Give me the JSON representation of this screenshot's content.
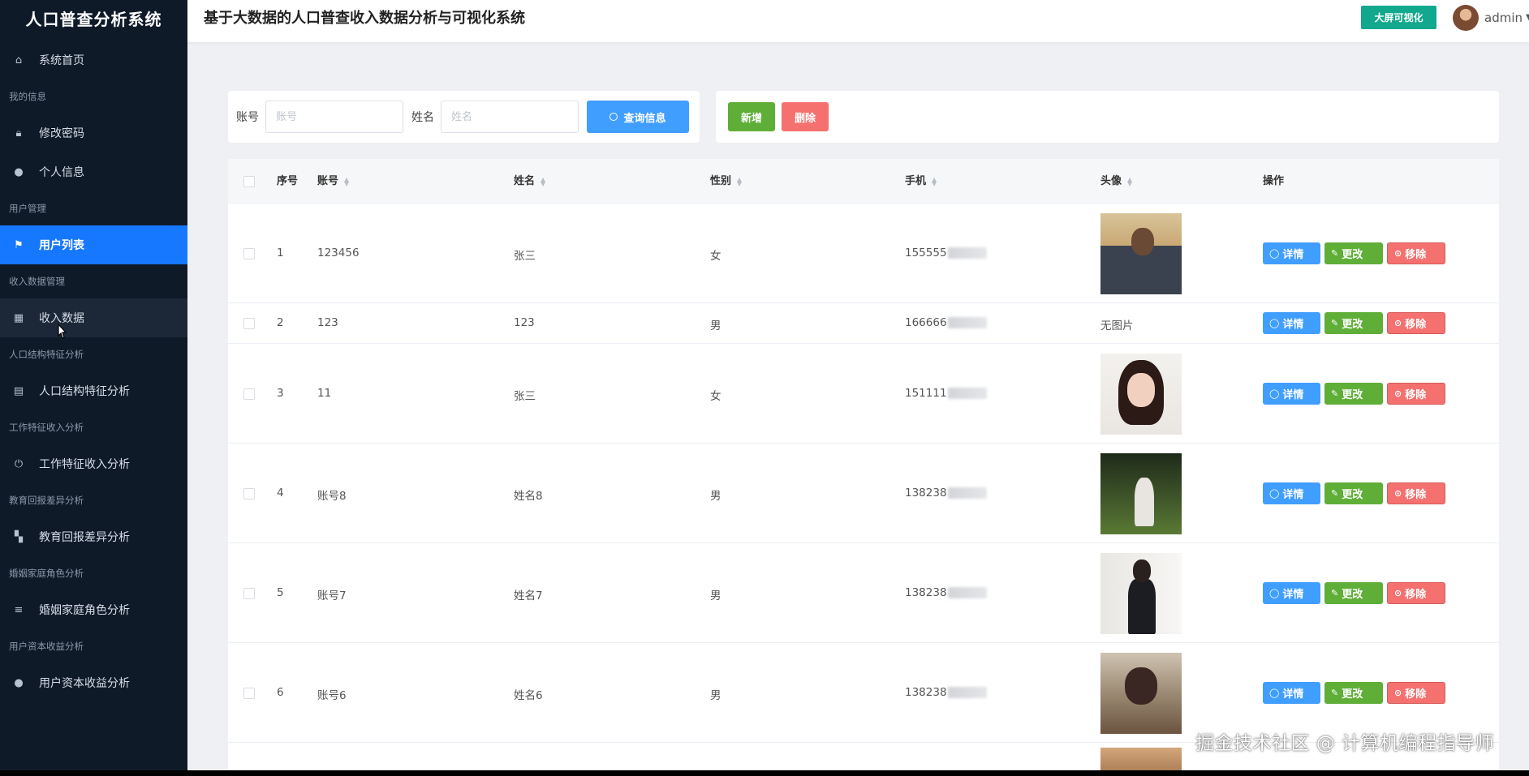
{
  "sidebar": {
    "brand": "人口普查分析系统",
    "items": [
      {
        "type": "item",
        "label": "系统首页",
        "icon": "home-icon"
      },
      {
        "type": "group",
        "label": "我的信息"
      },
      {
        "type": "item",
        "label": "修改密码",
        "icon": "lock-icon"
      },
      {
        "type": "item",
        "label": "个人信息",
        "icon": "user-icon"
      },
      {
        "type": "group",
        "label": "用户管理"
      },
      {
        "type": "item",
        "label": "用户列表",
        "icon": "flag-icon",
        "active": true
      },
      {
        "type": "group",
        "label": "收入数据管理"
      },
      {
        "type": "item",
        "label": "收入数据",
        "icon": "chart-icon"
      },
      {
        "type": "group",
        "label": "人口结构特征分析"
      },
      {
        "type": "item",
        "label": "人口结构特征分析",
        "icon": "clipboard-icon"
      },
      {
        "type": "group",
        "label": "工作特征收入分析"
      },
      {
        "type": "item",
        "label": "工作特征收入分析",
        "icon": "power-icon"
      },
      {
        "type": "group",
        "label": "教育回报差异分析"
      },
      {
        "type": "item",
        "label": "教育回报差异分析",
        "icon": "grid-icon"
      },
      {
        "type": "group",
        "label": "婚姻家庭角色分析"
      },
      {
        "type": "item",
        "label": "婚姻家庭角色分析",
        "icon": "list-icon"
      },
      {
        "type": "group",
        "label": "用户资本收益分析"
      },
      {
        "type": "item",
        "label": "用户资本收益分析",
        "icon": "bulb-icon"
      }
    ]
  },
  "header": {
    "title": "基于大数据的人口普查收入数据分析与可视化系统",
    "dashboard_label": "大屏可视化",
    "username": "admin"
  },
  "search": {
    "account_label": "账号",
    "account_placeholder": "账号",
    "name_label": "姓名",
    "name_placeholder": "姓名",
    "query_label": "查询信息"
  },
  "actions": {
    "add_label": "新增",
    "delete_label": "删除"
  },
  "table": {
    "columns": [
      "序号",
      "账号",
      "姓名",
      "性别",
      "手机",
      "头像",
      "操作"
    ],
    "rows": [
      {
        "index": "1",
        "account": "123456",
        "name": "张三",
        "gender": "女",
        "phone": "155555",
        "photo": "p1"
      },
      {
        "index": "2",
        "account": "123",
        "name": "123",
        "gender": "男",
        "phone": "166666",
        "photo": "",
        "no_photo_text": "无图片"
      },
      {
        "index": "3",
        "account": "11",
        "name": "张三",
        "gender": "女",
        "phone": "151111",
        "photo": "p3"
      },
      {
        "index": "4",
        "account": "账号8",
        "name": "姓名8",
        "gender": "男",
        "phone": "138238",
        "photo": "p4"
      },
      {
        "index": "5",
        "account": "账号7",
        "name": "姓名7",
        "gender": "男",
        "phone": "138238",
        "photo": "p5"
      },
      {
        "index": "6",
        "account": "账号6",
        "name": "姓名6",
        "gender": "男",
        "phone": "138238",
        "photo": "p6"
      }
    ],
    "op_detail": "详情",
    "op_edit": "更改",
    "op_remove": "移除"
  },
  "watermark": "掘金技术社区 @ 计算机编程指导师"
}
